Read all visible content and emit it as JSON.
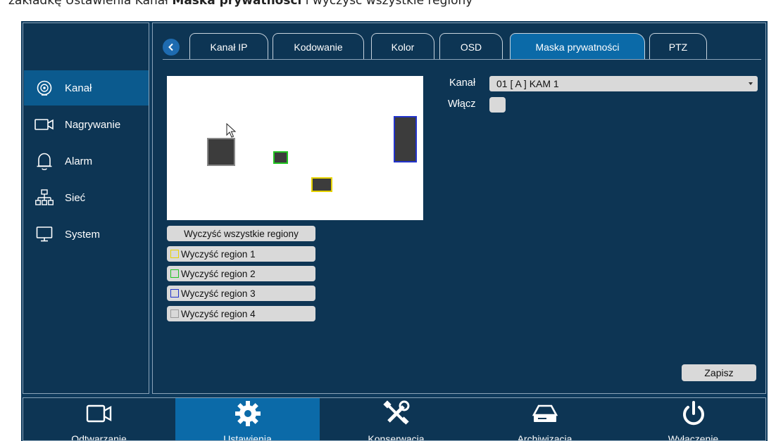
{
  "caption_strip": {
    "text_before": "zakładkę Ustawienia  Kanał  ",
    "bold": "Maska prywatności",
    "text_after": " i wyczyść wszystkie regiony"
  },
  "sidebar": {
    "items": [
      {
        "label": "Kanał",
        "icon": "camera-icon",
        "active": true
      },
      {
        "label": "Nagrywanie",
        "icon": "video-camera-icon",
        "active": false
      },
      {
        "label": "Alarm",
        "icon": "bell-icon",
        "active": false
      },
      {
        "label": "Sieć",
        "icon": "network-icon",
        "active": false
      },
      {
        "label": "System",
        "icon": "monitor-icon",
        "active": false
      }
    ]
  },
  "tabs": [
    {
      "label": "Kanał IP",
      "active": false
    },
    {
      "label": "Kodowanie",
      "active": false
    },
    {
      "label": "Kolor",
      "active": false
    },
    {
      "label": "OSD",
      "active": false
    },
    {
      "label": "Maska prywatności",
      "active": true
    },
    {
      "label": "PTZ",
      "active": false
    }
  ],
  "form": {
    "channel_label": "Kanał",
    "channel_value": "01 [ A ] KAM 1",
    "enable_label": "Włącz",
    "enable_checked": false
  },
  "buttons": {
    "clear_all": "Wyczyść wszystkie regiony",
    "clear_region_1": "Wyczyść region 1",
    "clear_region_2": "Wyczyść region 2",
    "clear_region_3": "Wyczyść region 3",
    "clear_region_4": "Wyczyść region 4",
    "save": "Zapisz"
  },
  "region_colors": {
    "region_1": "#e6d200",
    "region_2": "#22c422",
    "region_3": "#2233cc",
    "region_4": "#9a9a9a"
  },
  "bottom_nav": [
    {
      "label": "Odtwarzanie",
      "icon": "video-camera-icon",
      "active": false
    },
    {
      "label": "Ustawienia",
      "icon": "gear-icon",
      "active": true
    },
    {
      "label": "Konserwacja",
      "icon": "tools-icon",
      "active": false
    },
    {
      "label": "Archiwizacja",
      "icon": "drive-icon",
      "active": false
    },
    {
      "label": "Wyłączenie",
      "icon": "power-icon",
      "active": false
    }
  ]
}
